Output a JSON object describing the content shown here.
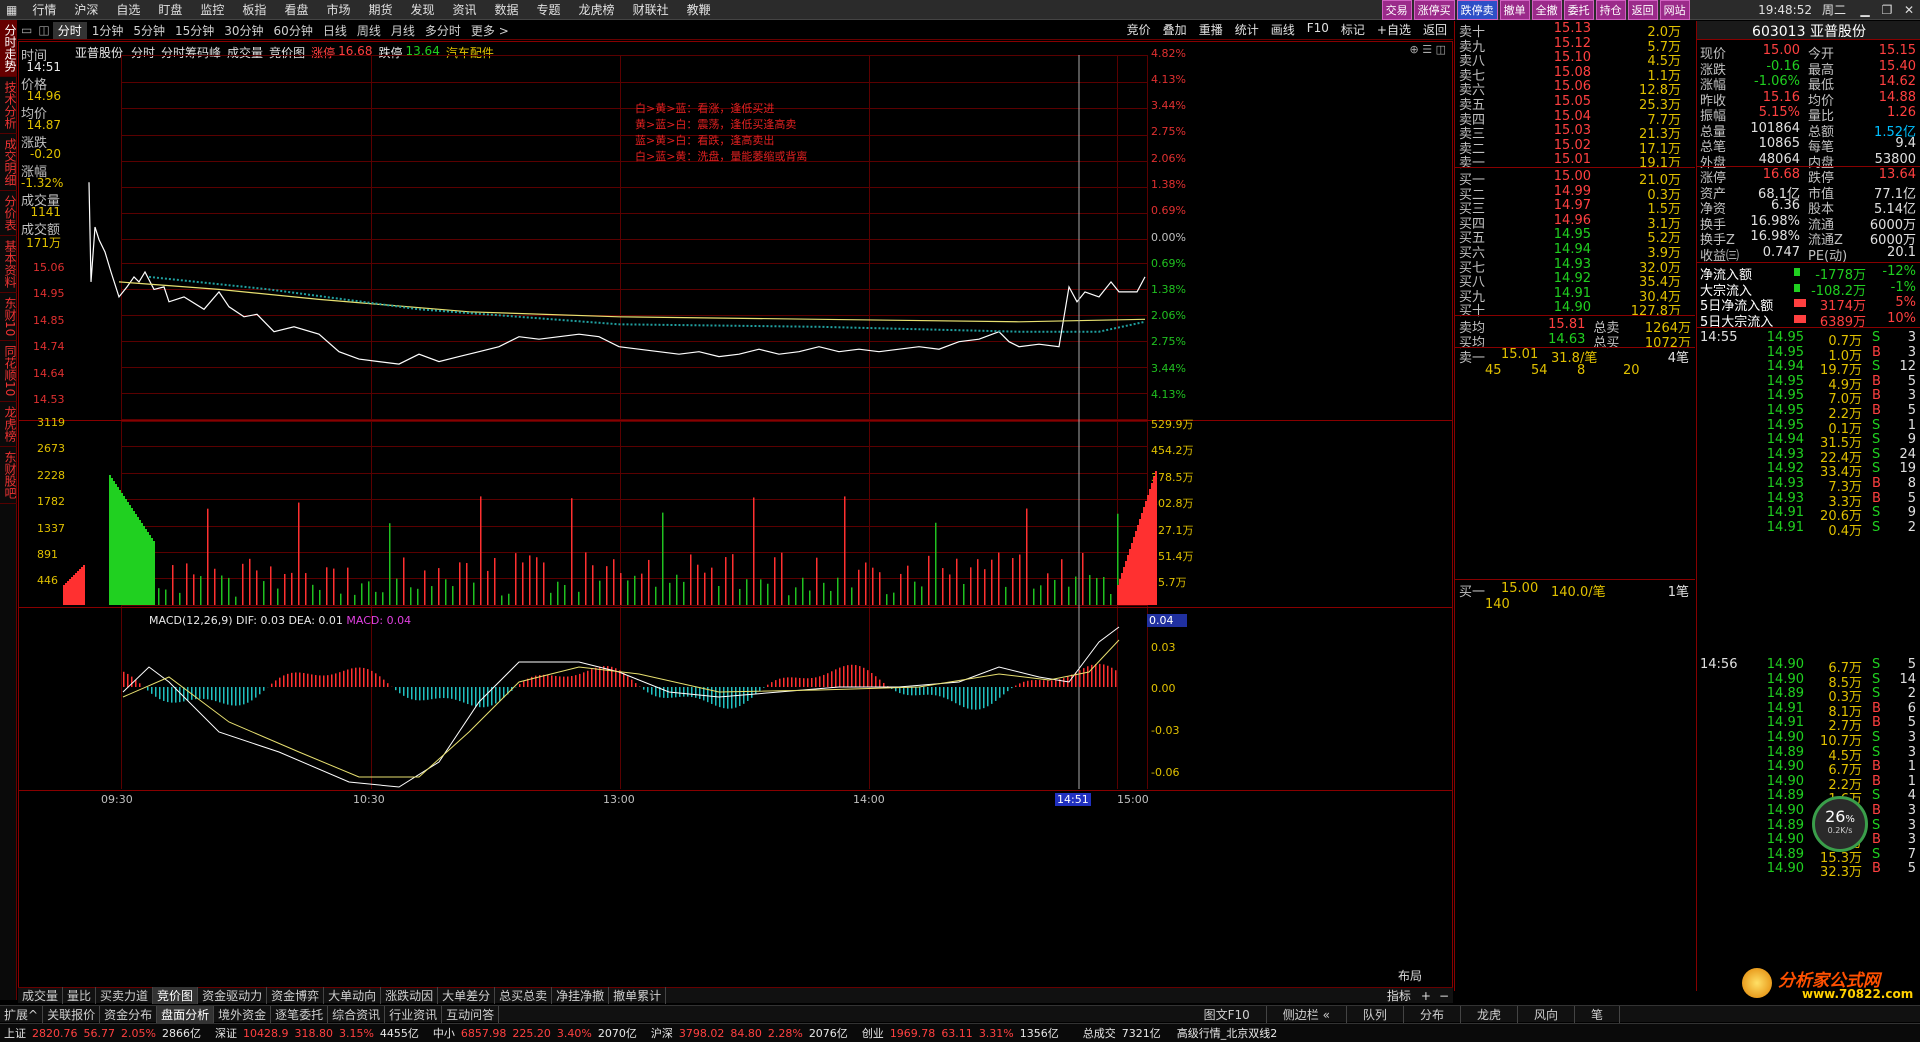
{
  "menu": [
    "行情",
    "沪深",
    "自选",
    "盯盘",
    "监控",
    "板指",
    "看盘",
    "市场",
    "期货",
    "发现",
    "资讯",
    "数据",
    "专题",
    "龙虎榜",
    "财联社",
    "教鞭"
  ],
  "menu_buttons": [
    "交易",
    "涨停买",
    "跌停卖",
    "撤单",
    "全撤",
    "委托",
    "持仓",
    "返回",
    "网站"
  ],
  "clock": "19:48:52",
  "weekday": "周二",
  "left_tabs": [
    "分时走势",
    "技术分析",
    "成交明细",
    "分价表",
    "基本资料",
    "东财10",
    "同花顺10",
    "龙虎榜",
    "东财股吧"
  ],
  "periods": [
    "分时",
    "1分钟",
    "5分钟",
    "15分钟",
    "30分钟",
    "60分钟",
    "日线",
    "周线",
    "月线",
    "多分时",
    "更多 >"
  ],
  "right_tools": [
    "竞价",
    "叠加",
    "重播",
    "统计",
    "画线",
    "F10",
    "标记",
    "+自选",
    "返回"
  ],
  "chart_header": {
    "stock": "亚普股份",
    "items": [
      "分时",
      "分时筹码峰",
      "成交量",
      "竞价图"
    ],
    "limit_up_label": "涨停",
    "limit_up": "16.68",
    "limit_down_label": "跌停",
    "limit_down": "13.64",
    "sector": "汽车配件"
  },
  "info_panel": {
    "time_label": "时间",
    "time": "14:51",
    "price_label": "价格",
    "price": "14.96",
    "avg_label": "均价",
    "avg": "14.87",
    "change_label": "涨跌",
    "change": "-0.20",
    "pct_label": "涨幅",
    "pct": "-1.32%",
    "vol_label": "成交量",
    "vol": "1141",
    "amt_label": "成交额",
    "amt": "171万"
  },
  "price_axis_left": [
    "15.06",
    "14.95",
    "14.85",
    "14.74",
    "14.64",
    "14.53"
  ],
  "pct_axis_right": [
    "4.82%",
    "4.13%",
    "3.44%",
    "2.75%",
    "2.06%",
    "1.38%",
    "0.69%",
    "0.00%",
    "0.69%",
    "1.38%",
    "2.06%",
    "2.75%",
    "3.44%",
    "4.13%"
  ],
  "vol_axis_left": [
    "3119",
    "2673",
    "2228",
    "1782",
    "1337",
    "891",
    "446"
  ],
  "vol_axis_right": [
    "529.9万",
    "454.2万",
    "378.5万",
    "302.8万",
    "227.1万",
    "151.4万",
    "75.7万"
  ],
  "macd_axis_right": [
    "0.04",
    "0.03",
    "0.00",
    "-0.03",
    "-0.06"
  ],
  "macd_header": {
    "name": "MACD(12,26,9)",
    "dif_label": "DIF:",
    "dif": "0.03",
    "dea_label": "DEA:",
    "dea": "0.01",
    "macd_label": "MACD:",
    "macd": "0.04"
  },
  "legend_notes": [
    "白>黄>蓝：看涨，逢低买进",
    "黄>蓝>白：震荡，逢低买逢高卖",
    "蓝>黄>白：看跌，逢高卖出",
    "白>蓝>黄：洗盘，量能萎缩或背离"
  ],
  "time_axis": [
    "09:30",
    "10:30",
    "13:00",
    "14:00",
    "14:51",
    "15:00"
  ],
  "layout_label": "布局",
  "indicator_label": "指标",
  "bottom_tabs1": [
    "成交量",
    "量比",
    "买卖力道",
    "竞价图",
    "资金驱动力",
    "资金博弈",
    "大单动向",
    "涨跌动因",
    "大单差分",
    "总买总卖",
    "净挂净撤",
    "撤单累计"
  ],
  "bottom_tabs2": [
    "扩展^",
    "关联报价",
    "资金分布",
    "盘面分析",
    "境外资金",
    "逐笔委托",
    "综合资讯",
    "行业资讯",
    "互动问答"
  ],
  "bottom_right": [
    "图文F10",
    "侧边栏 «",
    "队列",
    "分布",
    "龙虎",
    "风向",
    "笔"
  ],
  "sell_levels": [
    {
      "n": "卖十",
      "p": "15.13",
      "v": "2.0万"
    },
    {
      "n": "卖九",
      "p": "15.12",
      "v": "5.7万"
    },
    {
      "n": "卖八",
      "p": "15.10",
      "v": "4.5万"
    },
    {
      "n": "卖七",
      "p": "15.08",
      "v": "1.1万"
    },
    {
      "n": "卖六",
      "p": "15.06",
      "v": "12.8万"
    },
    {
      "n": "卖五",
      "p": "15.05",
      "v": "25.3万"
    },
    {
      "n": "卖四",
      "p": "15.04",
      "v": "7.7万"
    },
    {
      "n": "卖三",
      "p": "15.03",
      "v": "21.3万"
    },
    {
      "n": "卖二",
      "p": "15.02",
      "v": "17.1万"
    },
    {
      "n": "卖一",
      "p": "15.01",
      "v": "19.1万"
    }
  ],
  "buy_levels": [
    {
      "n": "买一",
      "p": "15.00",
      "v": "21.0万"
    },
    {
      "n": "买二",
      "p": "14.99",
      "v": "0.3万"
    },
    {
      "n": "买三",
      "p": "14.97",
      "v": "1.5万"
    },
    {
      "n": "买四",
      "p": "14.96",
      "v": "3.1万"
    },
    {
      "n": "买五",
      "p": "14.95",
      "v": "5.2万"
    },
    {
      "n": "买六",
      "p": "14.94",
      "v": "3.9万"
    },
    {
      "n": "买七",
      "p": "14.93",
      "v": "32.0万"
    },
    {
      "n": "买八",
      "p": "14.92",
      "v": "35.4万"
    },
    {
      "n": "买九",
      "p": "14.91",
      "v": "30.4万"
    },
    {
      "n": "买十",
      "p": "14.90",
      "v": "127.8万"
    }
  ],
  "book_summary": {
    "sell_avg_label": "卖均",
    "sell_avg": "15.81",
    "total_sell_label": "总卖",
    "total_sell": "1264万",
    "buy_avg_label": "买均",
    "buy_avg": "14.63",
    "total_buy_label": "总买",
    "total_buy": "1072万",
    "ask1_label": "卖一",
    "ask1_price": "15.01",
    "ask1_avg": "31.8/笔",
    "ask1_count": "4笔",
    "ask1_queue": [
      "45",
      "54",
      "8",
      "20"
    ],
    "bid1_label": "买一",
    "bid1_price": "15.00",
    "bid1_avg": "140.0/笔",
    "bid1_count": "1笔",
    "bid1_queue": [
      "140"
    ]
  },
  "quote": {
    "code_name": "603013 亚普股份",
    "rows": [
      {
        "l1": "现价",
        "v1": "15.00",
        "l2": "今开",
        "v2": "15.15"
      },
      {
        "l1": "涨跌",
        "v1": "-0.16",
        "l2": "最高",
        "v2": "15.40"
      },
      {
        "l1": "涨幅",
        "v1": "-1.06%",
        "l2": "最低",
        "v2": "14.62"
      },
      {
        "l1": "昨收",
        "v1": "15.16",
        "l2": "均价",
        "v2": "14.88"
      },
      {
        "l1": "振幅",
        "v1": "5.15%",
        "l2": "量比",
        "v2": "1.26"
      },
      {
        "l1": "总量",
        "v1": "101864",
        "l2": "总额",
        "v2": "1.52亿"
      },
      {
        "l1": "总笔",
        "v1": "10865",
        "l2": "每笔",
        "v2": "9.4"
      },
      {
        "l1": "外盘",
        "v1": "48064",
        "l2": "内盘",
        "v2": "53800"
      },
      {
        "l1": "涨停",
        "v1": "16.68",
        "l2": "跌停",
        "v2": "13.64"
      },
      {
        "l1": "资产",
        "v1": "68.1亿",
        "l2": "市值",
        "v2": "77.1亿"
      },
      {
        "l1": "净资",
        "v1": "6.36",
        "l2": "股本",
        "v2": "5.14亿"
      },
      {
        "l1": "换手",
        "v1": "16.98%",
        "l2": "流通",
        "v2": "6000万"
      },
      {
        "l1": "换手Z",
        "v1": "16.98%",
        "l2": "流通Z",
        "v2": "6000万"
      },
      {
        "l1": "收益㈢",
        "v1": "0.747",
        "l2": "PE(动)",
        "v2": "20.1"
      }
    ],
    "flows": [
      {
        "l": "净流入额",
        "v": "-1778万",
        "p": "-12%"
      },
      {
        "l": "大宗流入",
        "v": "-108.2万",
        "p": "-1%"
      },
      {
        "l": "5日净流入额",
        "v": "3174万",
        "p": "5%"
      },
      {
        "l": "5日大宗流入",
        "v": "6389万",
        "p": "10%"
      }
    ]
  },
  "ticks_1455_label": "14:55",
  "ticks_1455": [
    {
      "p": "14.95",
      "v": "0.7万",
      "s": "S",
      "n": "3"
    },
    {
      "p": "14.95",
      "v": "1.0万",
      "s": "B",
      "n": "3"
    },
    {
      "p": "14.94",
      "v": "19.7万",
      "s": "S",
      "n": "12"
    },
    {
      "p": "14.95",
      "v": "4.9万",
      "s": "B",
      "n": "5"
    },
    {
      "p": "14.95",
      "v": "7.0万",
      "s": "B",
      "n": "3"
    },
    {
      "p": "14.95",
      "v": "2.2万",
      "s": "B",
      "n": "5"
    },
    {
      "p": "14.95",
      "v": "0.1万",
      "s": "S",
      "n": "1"
    },
    {
      "p": "14.94",
      "v": "31.5万",
      "s": "S",
      "n": "9"
    },
    {
      "p": "14.93",
      "v": "22.4万",
      "s": "S",
      "n": "24"
    },
    {
      "p": "14.92",
      "v": "33.4万",
      "s": "S",
      "n": "19"
    },
    {
      "p": "14.93",
      "v": "7.3万",
      "s": "B",
      "n": "8"
    },
    {
      "p": "14.93",
      "v": "3.3万",
      "s": "B",
      "n": "5"
    },
    {
      "p": "14.91",
      "v": "20.6万",
      "s": "S",
      "n": "9"
    },
    {
      "p": "14.91",
      "v": "0.4万",
      "s": "S",
      "n": "2"
    }
  ],
  "ticks_1456_label": "14:56",
  "ticks_1456": [
    {
      "p": "14.90",
      "v": "6.7万",
      "s": "S",
      "n": "5"
    },
    {
      "p": "14.90",
      "v": "8.5万",
      "s": "S",
      "n": "14"
    },
    {
      "p": "14.89",
      "v": "0.3万",
      "s": "S",
      "n": "2"
    },
    {
      "p": "14.91",
      "v": "8.1万",
      "s": "B",
      "n": "6"
    },
    {
      "p": "14.91",
      "v": "2.7万",
      "s": "B",
      "n": "5"
    },
    {
      "p": "14.90",
      "v": "10.7万",
      "s": "S",
      "n": "3"
    },
    {
      "p": "14.89",
      "v": "4.5万",
      "s": "S",
      "n": "3"
    },
    {
      "p": "14.90",
      "v": "6.7万",
      "s": "B",
      "n": "1"
    },
    {
      "p": "14.90",
      "v": "2.2万",
      "s": "B",
      "n": "1"
    },
    {
      "p": "14.89",
      "v": "1.6万",
      "s": "S",
      "n": "4"
    },
    {
      "p": "14.90",
      "v": "2.8万",
      "s": "B",
      "n": "3"
    },
    {
      "p": "14.89",
      "v": "1.0万",
      "s": "S",
      "n": "3"
    },
    {
      "p": "14.90",
      "v": "4.8万",
      "s": "B",
      "n": "3"
    },
    {
      "p": "14.89",
      "v": "15.3万",
      "s": "S",
      "n": "7"
    },
    {
      "p": "14.90",
      "v": "32.3万",
      "s": "B",
      "n": "5"
    },
    {
      "p": "14.90",
      "v": "9.5万",
      "s": "B",
      "n": "7"
    }
  ],
  "speed": {
    "pct": "26",
    "unit": "%",
    "rate": "0.2K/s"
  },
  "watermark": {
    "name": "分析家公式网",
    "url": "www.70822.com"
  },
  "status": [
    {
      "n": "上证",
      "v": "2820.76",
      "c": "56.77",
      "p": "2.05%",
      "a": "2866亿"
    },
    {
      "n": "深证",
      "v": "10428.9",
      "c": "318.80",
      "p": "3.15%",
      "a": "4455亿"
    },
    {
      "n": "中小",
      "v": "6857.98",
      "c": "225.20",
      "p": "3.40%",
      "a": "2070亿"
    },
    {
      "n": "沪深",
      "v": "3798.02",
      "c": "84.80",
      "p": "2.28%",
      "a": "2076亿"
    },
    {
      "n": "创业",
      "v": "1969.78",
      "c": "63.11",
      "p": "3.31%",
      "a": "1356亿"
    }
  ],
  "total_label": "总成交",
  "total_amount": "7321亿",
  "feed": "高级行情_北京双线2",
  "colors": {
    "up": "#ff3030",
    "down": "#20d020",
    "frame": "#800000",
    "grid": "#5a0000",
    "price_line": "#ffffff",
    "avg_line": "#e8e070",
    "ma_line": "#20a0a0"
  }
}
